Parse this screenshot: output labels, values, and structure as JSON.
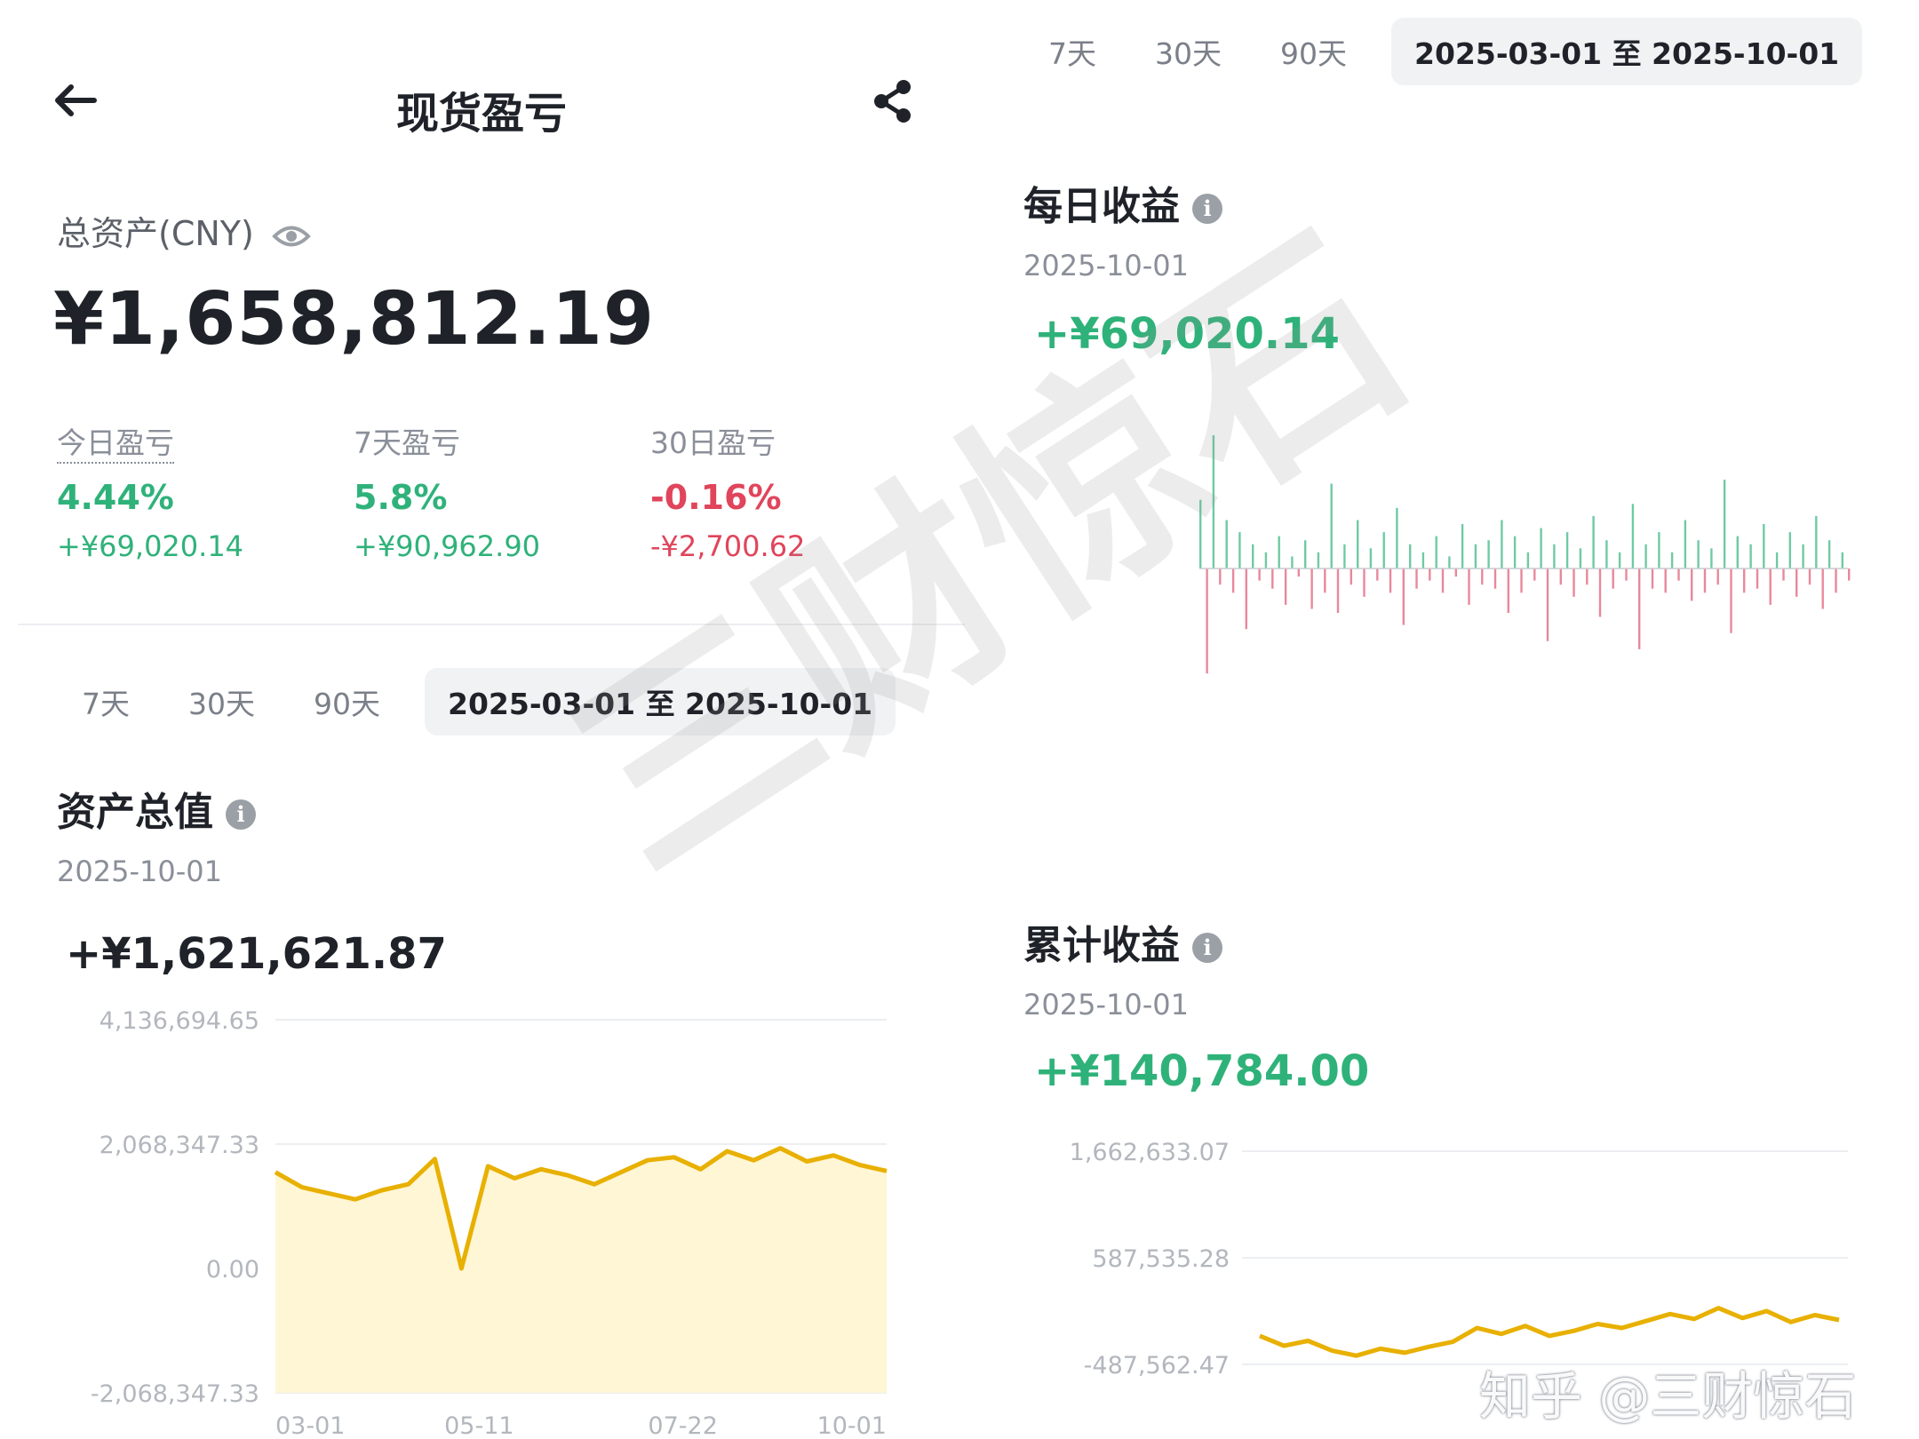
{
  "header": {
    "title": "现货盈亏",
    "back_icon": "arrow-left-icon",
    "share_icon": "share-icon"
  },
  "summary": {
    "total_label": "总资产(CNY)",
    "total_value": "¥1,658,812.19",
    "stats": [
      {
        "label": "今日盈亏",
        "pct": "4.44%",
        "amount": "+¥69,020.14",
        "tone": "green"
      },
      {
        "label": "7天盈亏",
        "pct": "5.8%",
        "amount": "+¥90,962.90",
        "tone": "green"
      },
      {
        "label": "30日盈亏",
        "pct": "-0.16%",
        "amount": "-¥2,700.62",
        "tone": "red"
      }
    ]
  },
  "range_tabs": [
    "7天",
    "30天",
    "90天"
  ],
  "range_active": "2025-03-01 至 2025-10-01",
  "asset_chart": {
    "title": "资产总值",
    "date": "2025-10-01",
    "value": "+¥1,621,621.87",
    "y_ticks": [
      "4,136,694.65",
      "2,068,347.33",
      "0.00",
      "-2,068,347.33"
    ],
    "x_ticks": [
      "03-01",
      "05-11",
      "07-22",
      "10-01"
    ]
  },
  "daily_chart": {
    "title": "每日收益",
    "date": "2025-10-01",
    "value": "+¥69,020.14"
  },
  "cumulative_chart": {
    "title": "累计收益",
    "date": "2025-10-01",
    "value": "+¥140,784.00",
    "y_ticks": [
      "1,662,633.07",
      "587,535.28",
      "-487,562.47"
    ]
  },
  "watermark": {
    "center": "三财惊石",
    "corner": "知乎 @三财惊石"
  },
  "chart_data": [
    {
      "type": "area",
      "title": "资产总值",
      "x": [
        "03-01",
        "05-11",
        "07-22",
        "10-01"
      ],
      "ylim": [
        -2068347.33,
        4136694.65
      ],
      "series": [
        {
          "values": [
            1600000,
            1350000,
            1250000,
            1150000,
            1300000,
            1400000,
            1820000,
            0,
            1700000,
            1500000,
            1650000,
            1550000,
            1400000,
            1600000,
            1800000,
            1850000,
            1650000,
            1950000,
            1800000,
            2000000,
            1780000,
            1880000,
            1720000,
            1620000
          ]
        }
      ],
      "color": "#e8b000",
      "fill": "#fff6d6"
    },
    {
      "type": "bar",
      "title": "每日收益",
      "series": [
        {
          "values": [
            170,
            -260,
            330,
            -40,
            120,
            -60,
            90,
            -150,
            60,
            -30,
            40,
            -50,
            80,
            -90,
            30,
            -20,
            70,
            -100,
            40,
            -60,
            210,
            -110,
            60,
            -40,
            120,
            -70,
            50,
            -30,
            90,
            -60,
            150,
            -140,
            60,
            -50,
            40,
            -30,
            80,
            -60,
            30,
            -20,
            110,
            -90,
            60,
            -40,
            70,
            -50,
            120,
            -110,
            80,
            -60,
            40,
            -30,
            100,
            -180,
            60,
            -40,
            90,
            -70,
            50,
            -40,
            130,
            -120,
            70,
            -50,
            40,
            -30,
            160,
            -200,
            60,
            -50,
            90,
            -60,
            40,
            -30,
            120,
            -80,
            70,
            -60,
            50,
            -40,
            220,
            -160,
            80,
            -60,
            60,
            -50,
            110,
            -90,
            40,
            -30,
            90,
            -70,
            60,
            -40,
            130,
            -100,
            70,
            -60,
            40,
            -30
          ]
        }
      ],
      "colors": {
        "positive": "#3fb884",
        "negative": "#e0607a"
      }
    },
    {
      "type": "line",
      "title": "累计收益",
      "ylim": [
        -487562.47,
        1662633.07
      ],
      "series": [
        {
          "values": [
            -200000,
            -300000,
            -250000,
            -350000,
            -400000,
            -330000,
            -370000,
            -310000,
            -260000,
            -120000,
            -180000,
            -100000,
            -200000,
            -150000,
            -80000,
            -120000,
            -50000,
            20000,
            -30000,
            80000,
            -20000,
            50000,
            -60000,
            10000,
            -40000
          ]
        }
      ],
      "color": "#e8b000"
    }
  ]
}
